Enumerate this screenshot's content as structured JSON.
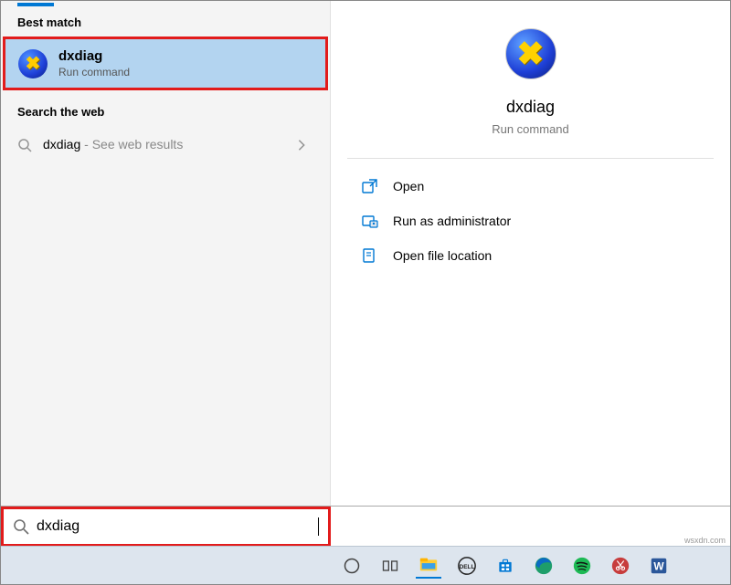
{
  "left": {
    "sections": {
      "best_match": "Best match",
      "search_web": "Search the web"
    },
    "best_match_item": {
      "title": "dxdiag",
      "subtitle": "Run command"
    },
    "web_item": {
      "term": "dxdiag",
      "see": " - See web results"
    }
  },
  "right": {
    "title": "dxdiag",
    "subtitle": "Run command",
    "actions": {
      "open": "Open",
      "run_admin": "Run as administrator",
      "open_loc": "Open file location"
    }
  },
  "search": {
    "value": "dxdiag"
  },
  "watermark": "wsxdn.com"
}
